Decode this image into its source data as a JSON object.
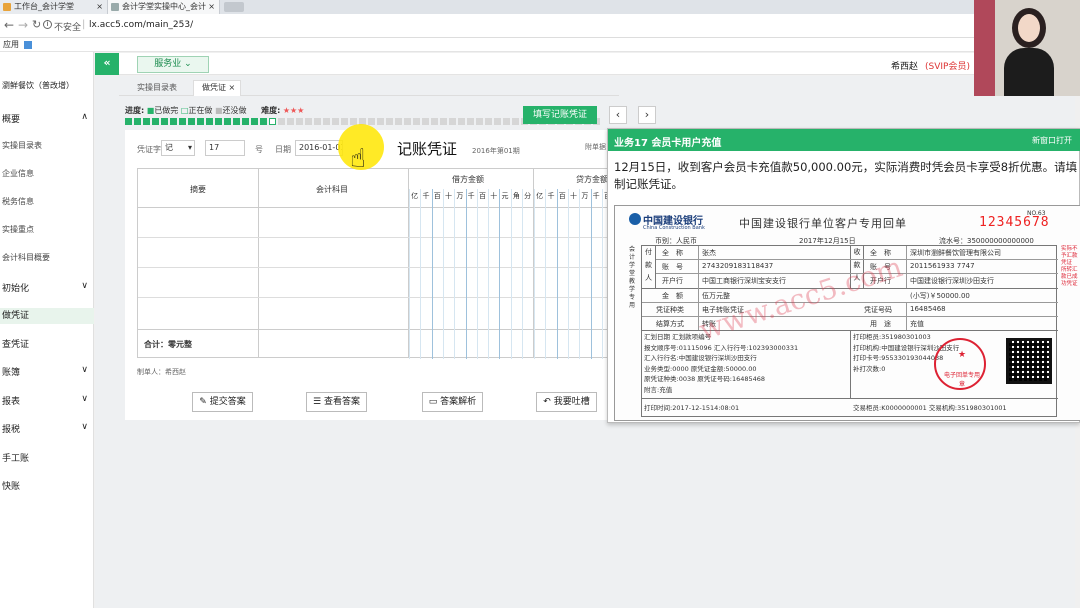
{
  "browser": {
    "tabs": [
      {
        "label": "工作台_会计学堂",
        "close": "×"
      },
      {
        "label": "会计学堂实操中心_会计",
        "close": "×"
      }
    ],
    "security": "不安全",
    "url": "lx.acc5.com/main_253/",
    "bookmarks_label": "应用"
  },
  "header": {
    "business_btn": "服务业",
    "user_name": "希西赵",
    "vip": "(SVIP会员)"
  },
  "sidebar": {
    "company": "瀏鲜餐饮（普改增）",
    "items": [
      {
        "label": "概要",
        "chev": "∧"
      },
      {
        "label": "实操目录表"
      },
      {
        "label": "企业信息"
      },
      {
        "label": "税务信息"
      },
      {
        "label": "实操重点"
      },
      {
        "label": "会计科目概要"
      },
      {
        "label": "初始化",
        "chev": "∨"
      },
      {
        "label": "做凭证"
      },
      {
        "label": "查凭证"
      },
      {
        "label": "账簿",
        "chev": "∨"
      },
      {
        "label": "报表",
        "chev": "∨"
      },
      {
        "label": "报税",
        "chev": "∨"
      },
      {
        "label": "手工账"
      },
      {
        "label": "快账"
      }
    ]
  },
  "tabs": {
    "items": [
      {
        "label": "实操目录表"
      },
      {
        "label": "做凭证",
        "close": "×"
      }
    ]
  },
  "progress": {
    "label": "进度:",
    "done": "已做完",
    "doing": "正在做",
    "todo": "还没做",
    "difficulty": "难度:",
    "stars": "★★★",
    "fill_btn": "填写记账凭证",
    "prev": "‹",
    "next": "›"
  },
  "voucher": {
    "word_label": "凭证字",
    "word_value": "记",
    "num_value": "17",
    "num_unit": "号",
    "date_label": "日期",
    "date_value": "2016-01-01",
    "title": "记账凭证",
    "period": "2016年第01期",
    "attach": "附单据",
    "col_summary": "摘要",
    "col_account": "会计科目",
    "col_debit": "借方金额",
    "col_credit": "贷方金额",
    "digits": [
      "亿",
      "千",
      "百",
      "十",
      "万",
      "千",
      "百",
      "十",
      "元",
      "角",
      "分"
    ],
    "total": "合计：零元整",
    "maker": "制单人：希西赵"
  },
  "actions": {
    "submit": "提交答案",
    "view": "查看答案",
    "analysis": "答案解析",
    "complain": "我要吐槽"
  },
  "task": {
    "title": "业务17 会员卡用户充值",
    "new_window": "新窗口打开",
    "desc": "12月15日，收到客户会员卡充值款50,000.00元，实际消费时凭会员卡享受8折优惠。请填制记账凭证。"
  },
  "receipt": {
    "bank_cn": "中国建设银行",
    "bank_en": "China Construction Bank",
    "title": "中国建设银行单位客户专用回单",
    "no_label": "NO.63",
    "no_value": "12345678",
    "currency": "币别：人民币",
    "date": "2017年12月15日",
    "serial": "流水号：350000000000000",
    "side_label": "会计学堂教学专用",
    "payer_label": "付款人",
    "payee_label": "收款人",
    "rows": [
      {
        "k1": "全　称",
        "v1": "张杰",
        "k2": "全　称",
        "v2": "深圳市瀏鲜餐饮管理有限公司"
      },
      {
        "k1": "账　号",
        "v1": "2743209183118437",
        "k2": "账　号",
        "v2": "2011561933 7747"
      },
      {
        "k1": "开户行",
        "v1": "中国工商银行深圳宝安支行",
        "k2": "开户行",
        "v2": "中国建设银行深圳沙田支行"
      }
    ],
    "amount_label": "金　额",
    "amount_cn": "伍万元整",
    "amount_num": "(小写)￥50000.00",
    "voucher_type_label": "凭证种类",
    "voucher_type": "电子转账凭证",
    "voucher_no_label": "凭证号码",
    "voucher_no": "16485468",
    "settle_label": "结算方式",
    "settle": "转账",
    "use_label": "用　途",
    "use": "充值",
    "detail_left": [
      "汇划日期 汇划款项编号",
      "报文顺序号:01115096 汇入行行号:102393000331",
      "汇入行行名:中国建设银行深圳沙田支行",
      "业务类型:0000 原凭证金额:50000.00",
      "原凭证种类:0038 原凭证号码:16485468",
      "附言:充值"
    ],
    "detail_right": [
      "打印柜员:351980301003",
      "打印机构:中国建设银行深圳沙田支行",
      "打印卡号:955330193044038",
      "补打次数:0"
    ],
    "print_time": "打印时间:2017-12-1514:08:01",
    "teller": "交易柜员:K0000000001 交易机构:351980301001",
    "seal_text": "电子回单专用章",
    "watermark": "www.acc5.com",
    "right_notes": [
      "实际不予汇款凭证",
      "所转汇款已成功凭证",
      "并非在回执代理机构",
      "前转出凭证交给公司"
    ]
  }
}
